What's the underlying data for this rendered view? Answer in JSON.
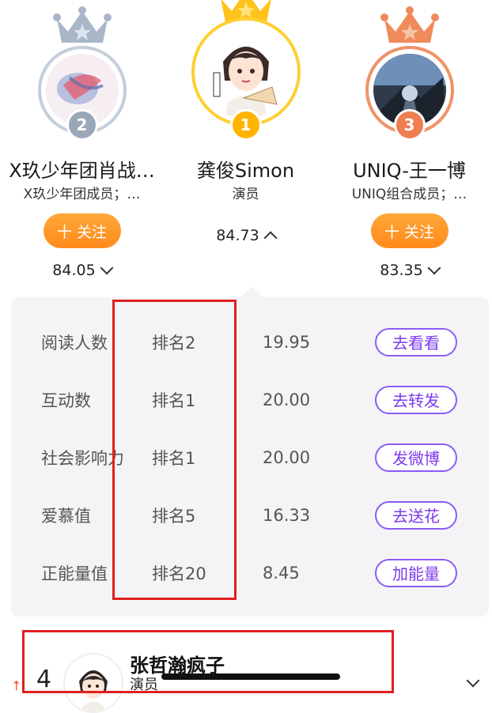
{
  "podium": [
    {
      "position": 2,
      "name": "X玖少年团肖战…",
      "desc": "X玖少年团成员；…",
      "follow_label": "十 关注",
      "score": "84.05",
      "crown_color": "#a9b6c8",
      "ring_color": "#c4cedb",
      "badge_color": "#9aa7b8",
      "expanded": false
    },
    {
      "position": 1,
      "name": "龚俊Simon",
      "desc": "演员",
      "score": "84.73",
      "crown_color": "#ffc21a",
      "ring_color": "#ffcf33",
      "badge_color": "#ffb400",
      "expanded": true
    },
    {
      "position": 3,
      "name": "UNIQ-王一博",
      "desc": "UNIQ组合成员；…",
      "follow_label": "十 关注",
      "score": "83.35",
      "crown_color": "#ef8a5b",
      "ring_color": "#f0926a",
      "badge_color": "#ee7d4f",
      "expanded": false
    }
  ],
  "detail": {
    "rows": [
      {
        "label": "阅读人数",
        "rank": "排名2",
        "score": "19.95",
        "action": "去看看"
      },
      {
        "label": "互动数",
        "rank": "排名1",
        "score": "20.00",
        "action": "去转发"
      },
      {
        "label": "社会影响力",
        "rank": "排名1",
        "score": "20.00",
        "action": "发微博"
      },
      {
        "label": "爱慕值",
        "rank": "排名5",
        "score": "16.33",
        "action": "去送花"
      },
      {
        "label": "正能量值",
        "rank": "排名20",
        "score": "8.45",
        "action": "加能量"
      }
    ],
    "accent_color": "#7c3aed"
  },
  "list_item": {
    "trend": "↑",
    "rank": "4",
    "name": "张哲瀚疯子",
    "desc": "演员"
  }
}
